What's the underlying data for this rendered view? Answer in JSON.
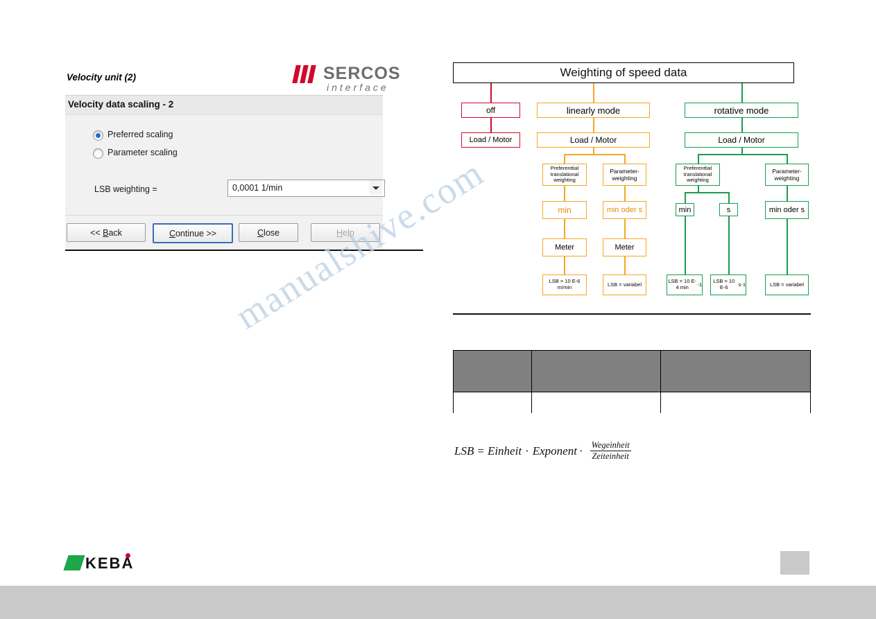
{
  "dialog": {
    "window_title": "Velocity unit (2)",
    "brand": {
      "name": "SERCOS",
      "subtitle": "interface"
    },
    "section_title": "Velocity data scaling - 2",
    "radios": [
      {
        "label": "Preferred scaling",
        "selected": true
      },
      {
        "label": "Parameter scaling",
        "selected": false
      }
    ],
    "lsb_label": "LSB weighting =",
    "lsb_value": "0,0001 1/min",
    "buttons": [
      {
        "label": "<< Back"
      },
      {
        "label": "Continue >>"
      },
      {
        "label": "Close"
      },
      {
        "label": "Help"
      }
    ]
  },
  "flow": {
    "title": "Weighting of speed data",
    "branches": {
      "off": {
        "mode": "off",
        "load_motor": "Load / Motor"
      },
      "linear": {
        "mode": "linearly mode",
        "load_motor": "Load / Motor",
        "left": {
          "weighting": "Preferenttial translational weighting",
          "unit": "min",
          "length": "Meter",
          "lsb": "LSB = 10 E-6 m/min"
        },
        "right": {
          "weighting": "Parameter-weighting",
          "unit": "min oder s",
          "length": "Meter",
          "lsb": "LSB = variabel"
        }
      },
      "rotative": {
        "mode": "rotative mode",
        "load_motor": "Load / Motor",
        "left": {
          "weighting": "Preferenttial translational weighting",
          "unit_a": "min",
          "unit_b": "s",
          "lsb_a": "LSB = 10 E-4 min",
          "lsb_a_sup": "-1",
          "lsb_b": "LSB = 10 E-6",
          "lsb_b_unit": "s",
          "lsb_b_sup": "-1"
        },
        "right": {
          "weighting": "Parameter-weighting",
          "unit": "min oder s",
          "lsb": "LSB = variabel"
        }
      }
    },
    "colors": {
      "off": "#cf0a2c",
      "linear": "#f5a623",
      "rotative": "#1a9c4e"
    }
  },
  "table": {
    "header": [
      "",
      "",
      ""
    ],
    "row": [
      "",
      "",
      ""
    ]
  },
  "formula": {
    "lhs": "LSB",
    "eq": "=",
    "term1": "Einheit",
    "dot1": "·",
    "term2": "Exponent",
    "dot2": "·",
    "numerator": "Wegeinheit",
    "denominator": "Zeiteinheit"
  },
  "footer": {
    "logo": "KEBA",
    "page_number": ""
  },
  "watermark": "manualshive.com"
}
